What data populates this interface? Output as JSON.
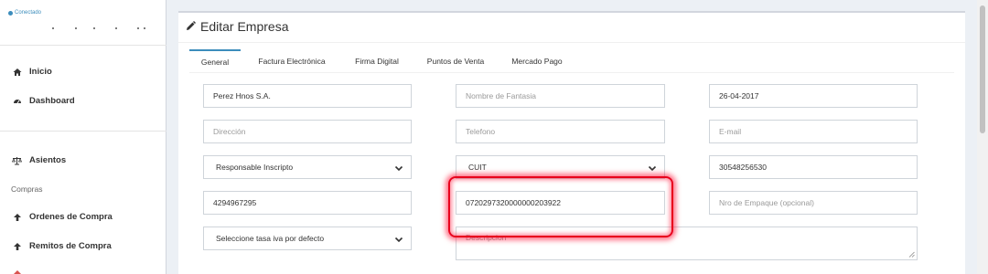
{
  "sidebar": {
    "status_text": "Conectado",
    "items": {
      "inicio": "Inicio",
      "dashboard": "Dashboard",
      "asientos": "Asientos",
      "compras_header": "Compras",
      "ordenes": "Ordenes de Compra",
      "remitos": "Remitos de Compra"
    }
  },
  "main": {
    "title": "Editar Empresa",
    "tabs": [
      "General",
      "Factura Electrónica",
      "Firma Digital",
      "Puntos de Venta",
      "Mercado Pago"
    ],
    "active_tab": "General"
  },
  "form": {
    "razon_social": "Perez Hnos S.A.",
    "nombre_fantasia_placeholder": "Nombre de Fantasia",
    "fecha": "26-04-2017",
    "direccion_placeholder": "Dirección",
    "telefono_placeholder": "Telefono",
    "email_placeholder": "E-mail",
    "condicion_iva": "Responsable Inscripto",
    "tipo_documento": "CUIT",
    "cuit": "30548256530",
    "field_4294": "4294967295",
    "cbu": "0720297320000000203922",
    "nro_empaque_placeholder": "Nro de Empaque (opcional)",
    "tasa_iva": "Seleccione tasa iva por defecto",
    "descripcion_placeholder": "Descripcion"
  },
  "colors": {
    "accent": "#3c8dbc",
    "highlight": "#e8001c"
  }
}
